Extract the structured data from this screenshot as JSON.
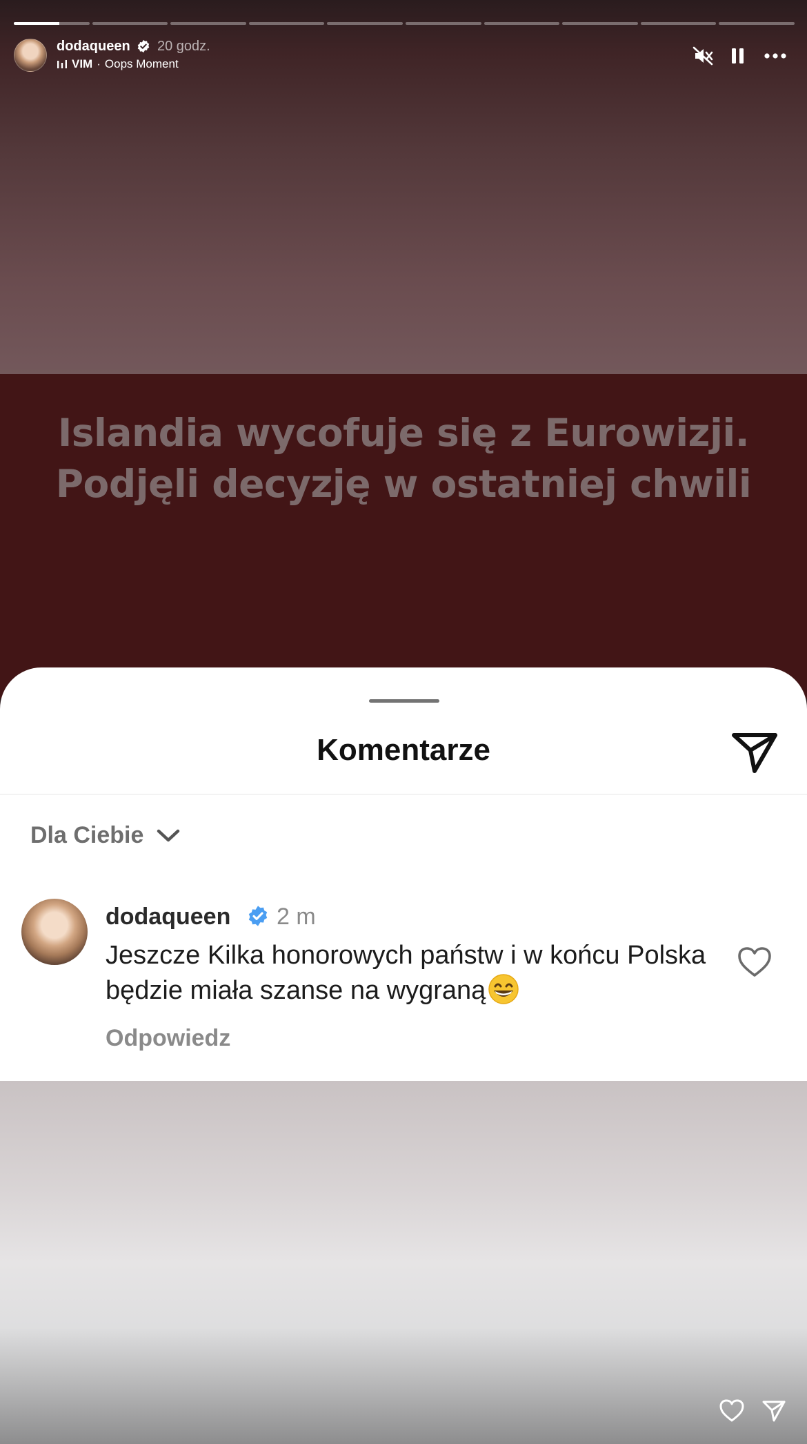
{
  "story": {
    "headline_line1": "Islandia wycofuje się z Eurowizji.",
    "headline_line2": "Podjęli decyzję w ostatniej chwili",
    "progress": {
      "segments": 10,
      "current_index": 0,
      "current_fill_fraction": 0.6
    }
  },
  "header": {
    "username": "dodaqueen",
    "time": "20 godz.",
    "music_artist": "VIM",
    "music_separator": "·",
    "music_title": "Oops Moment",
    "icons": [
      "muted-speaker-icon",
      "pause-icon",
      "more-icon"
    ]
  },
  "comments_sheet": {
    "title": "Komentarze",
    "filter_label": "Dla Ciebie",
    "comment": {
      "username": "dodaqueen",
      "time": "2 m",
      "text": "Jeszcze Kilka honorowych państw i w końcu Polska będzie miała szanse na wygraną",
      "emoji": "grinning-face-with-smiling-eyes",
      "reply_label": "Odpowiedz"
    }
  },
  "colors": {
    "headline_band": "#421516",
    "verified_blue": "#4b9ef2",
    "headline_text": "#7c6a6b"
  }
}
